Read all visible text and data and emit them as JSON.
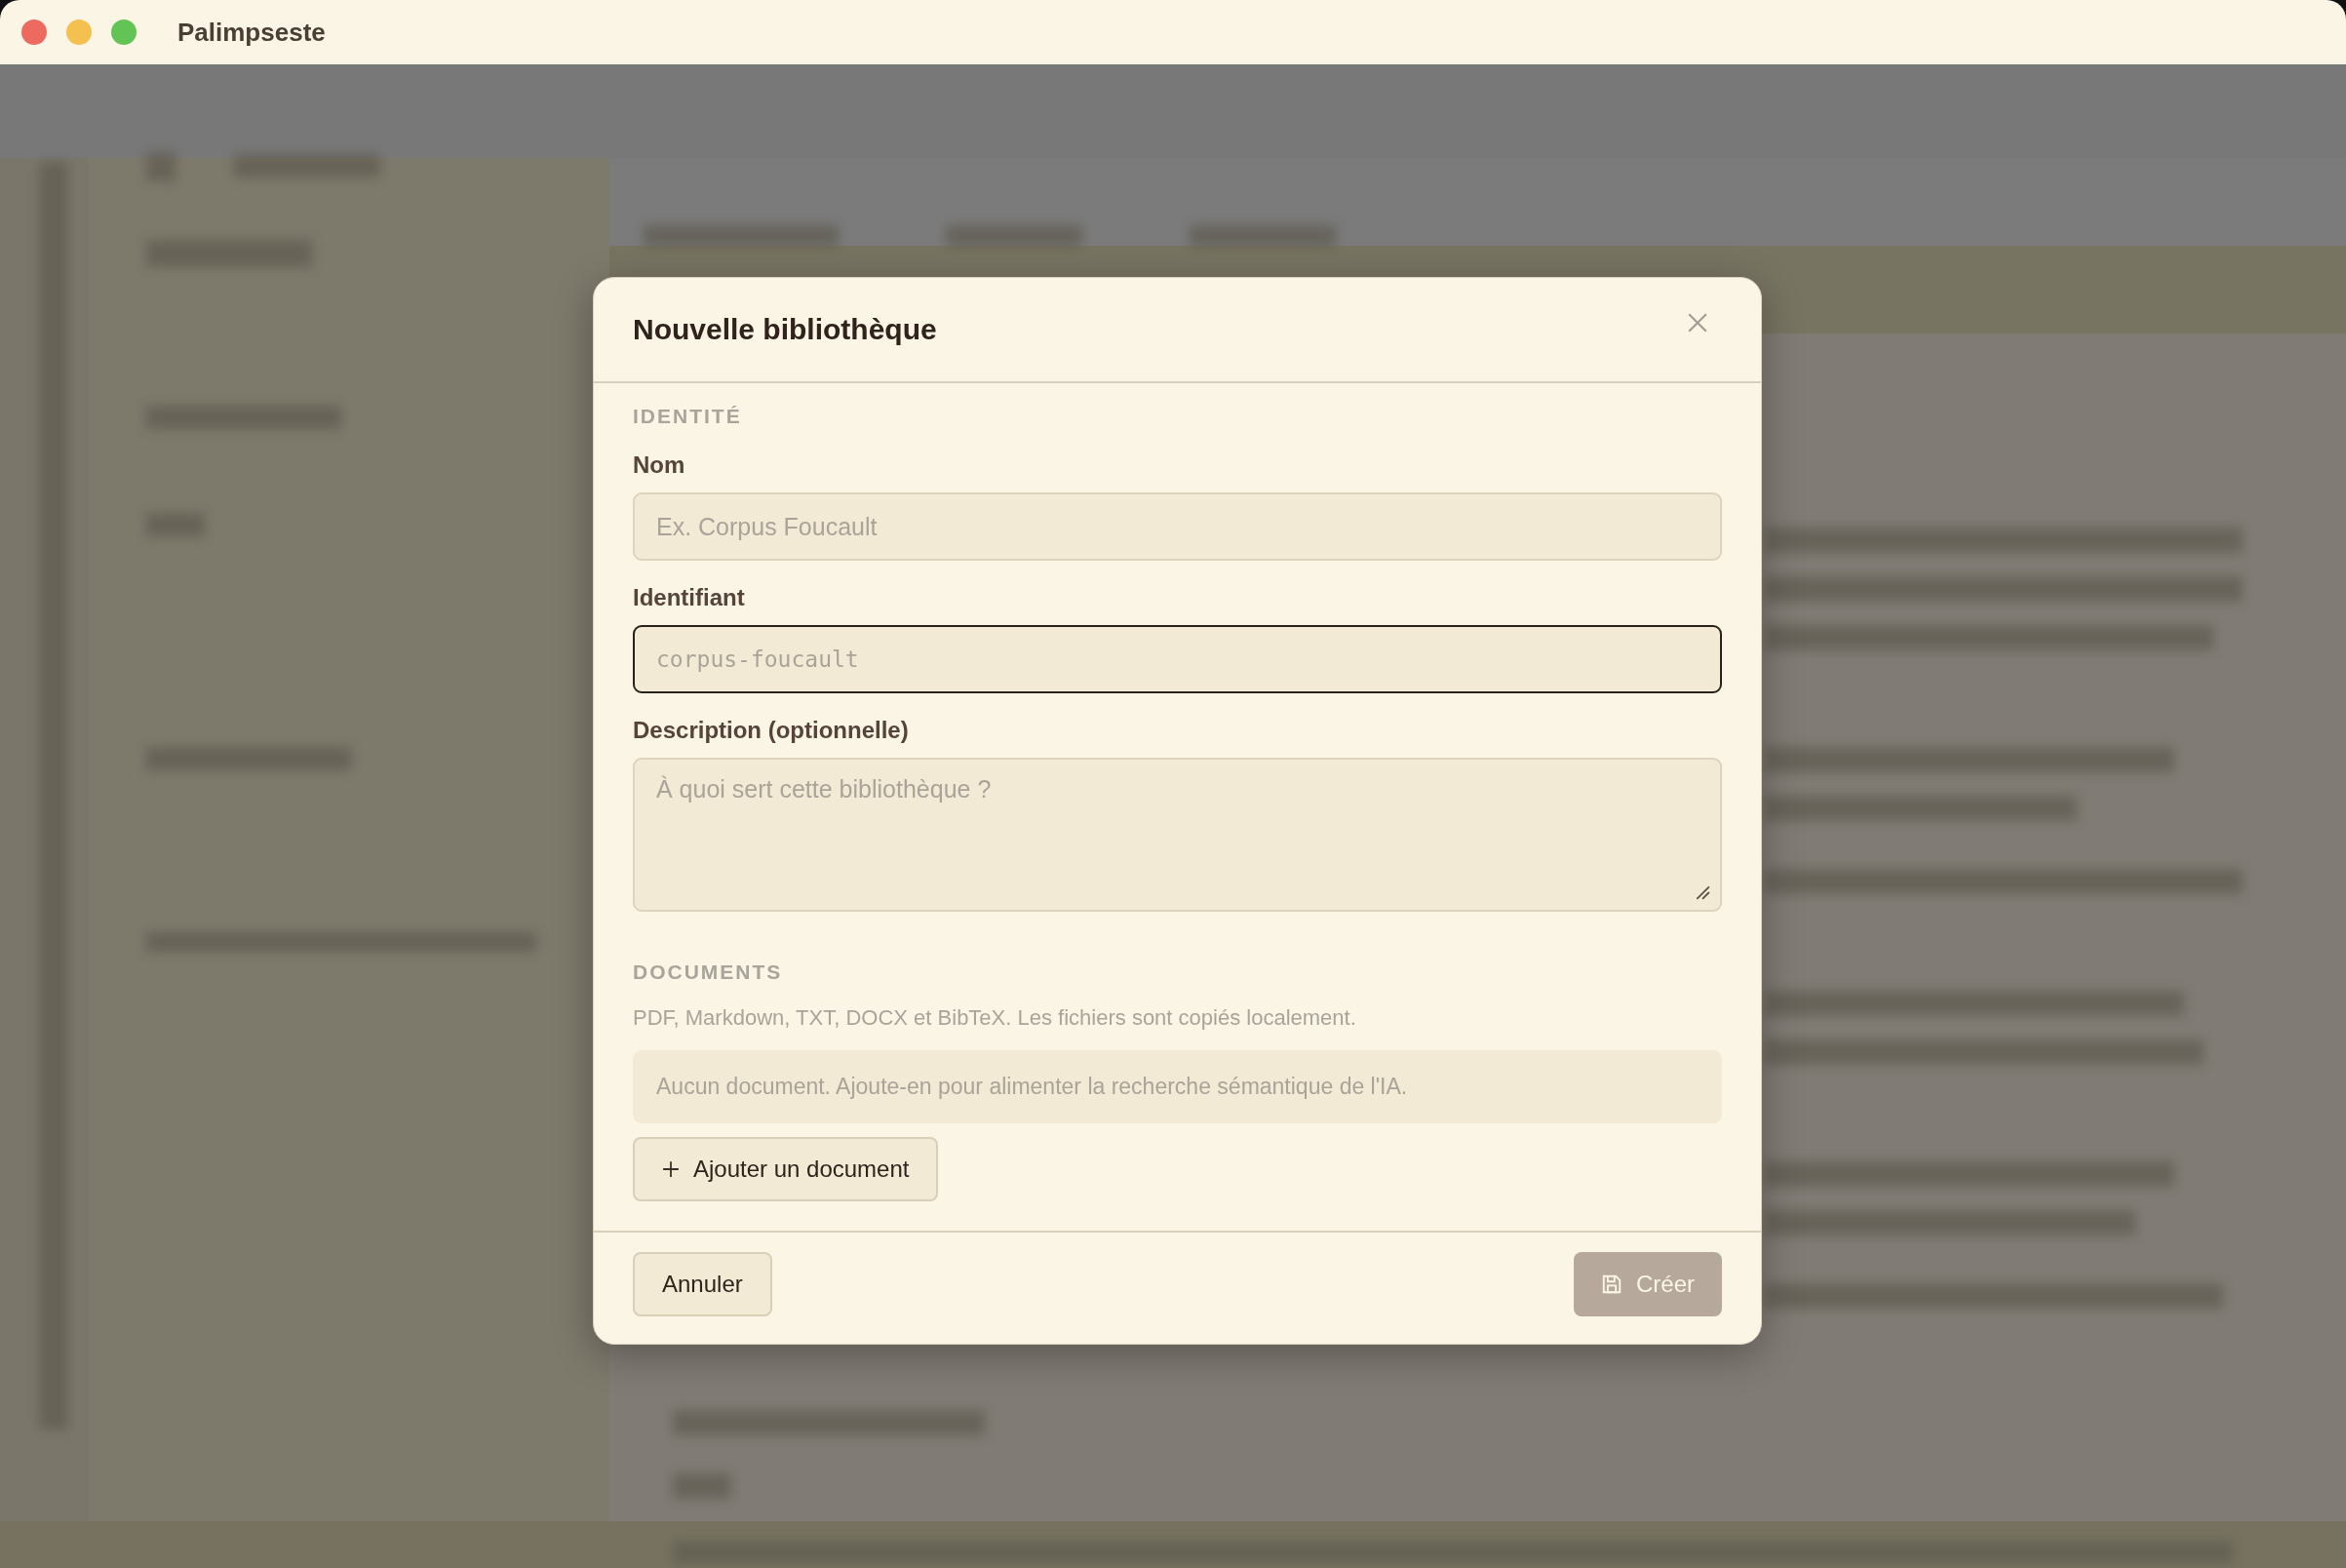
{
  "window": {
    "title": "Palimpseste"
  },
  "dialog": {
    "title": "Nouvelle bibliothèque",
    "identity": {
      "heading": "IDENTITÉ",
      "fields": [
        {
          "kind": "text",
          "label": "Nom",
          "placeholder": "Ex. Corpus Foucault",
          "focused": false
        },
        {
          "kind": "mono",
          "label": "Identifiant",
          "placeholder": "corpus-foucault",
          "focused": true
        },
        {
          "kind": "textarea",
          "label": "Description (optionnelle)",
          "placeholder": "À quoi sert cette bibliothèque ?",
          "focused": false
        }
      ]
    },
    "documents": {
      "heading": "DOCUMENTS",
      "note": "PDF, Markdown, TXT, DOCX et BibTeX. Les fichiers sont copiés localement.",
      "empty_message": "Aucun document. Ajoute-en pour alimenter la recherche sémantique de l'IA.",
      "add_button": "Ajouter un document"
    },
    "buttons": [
      {
        "kind": "secondary",
        "label": "Annuler",
        "disabled": false
      },
      {
        "kind": "primary",
        "label": "Créer",
        "disabled": true
      }
    ]
  }
}
